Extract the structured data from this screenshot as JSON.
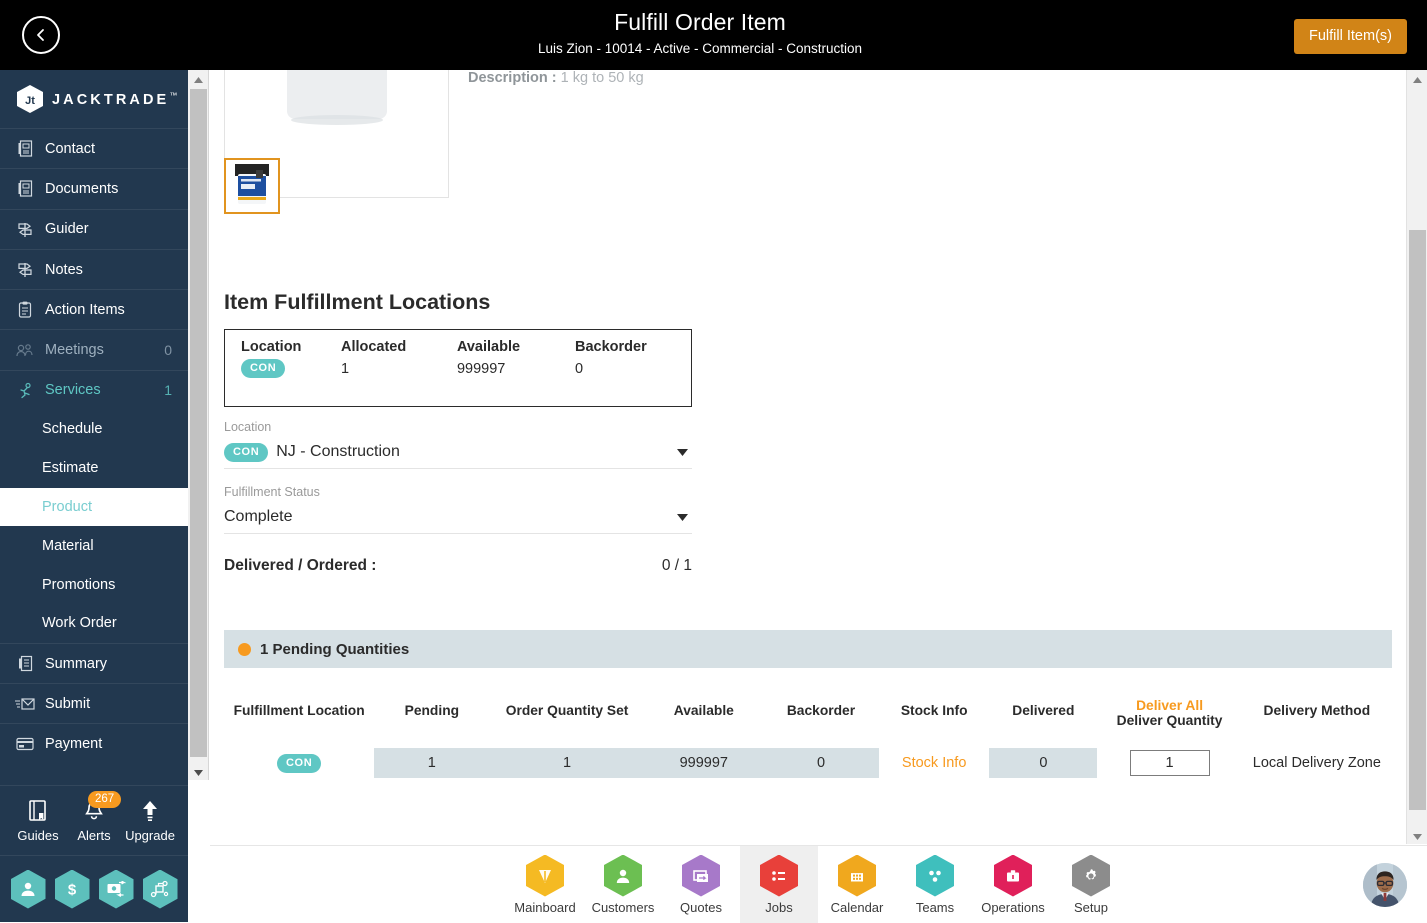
{
  "header": {
    "back_icon": "chevron-left-icon",
    "title": "Fulfill Order Item",
    "subtitle": "Luis Zion - 10014 - Active - Commercial - Construction",
    "fulfill_button": "Fulfill Item(s)",
    "accent_color": "#d18417",
    "background_color": "#000000"
  },
  "sidebar": {
    "brand": "JACKTRADE",
    "brand_tm": "™",
    "background_color": "#22384f",
    "active_color": "#79cdd0",
    "items": [
      {
        "label": "Contact",
        "icon": "contact-card-icon",
        "badge": ""
      },
      {
        "label": "Documents",
        "icon": "documents-icon",
        "badge": ""
      },
      {
        "label": "Guider",
        "icon": "signpost-icon",
        "badge": ""
      },
      {
        "label": "Notes",
        "icon": "signpost-icon",
        "badge": ""
      },
      {
        "label": "Action Items",
        "icon": "clipboard-icon",
        "badge": ""
      },
      {
        "label": "Meetings",
        "icon": "meetings-icon",
        "badge": "0"
      },
      {
        "label": "Services",
        "icon": "services-icon",
        "badge": "1"
      }
    ],
    "sub_items": [
      {
        "label": "Schedule",
        "active": false
      },
      {
        "label": "Estimate",
        "active": false
      },
      {
        "label": "Product",
        "active": true
      },
      {
        "label": "Material",
        "active": false
      },
      {
        "label": "Promotions",
        "active": false
      },
      {
        "label": "Work Order",
        "active": false
      }
    ],
    "items_after": [
      {
        "label": "Summary",
        "icon": "summary-icon",
        "badge": ""
      },
      {
        "label": "Submit",
        "icon": "submit-mail-icon",
        "badge": ""
      },
      {
        "label": "Payment",
        "icon": "payment-card-icon",
        "badge": ""
      }
    ],
    "tools": [
      {
        "label": "Guides",
        "icon": "book-icon",
        "badge": ""
      },
      {
        "label": "Alerts",
        "icon": "bell-icon",
        "badge": "267"
      },
      {
        "label": "Upgrade",
        "icon": "up-arrow-icon",
        "badge": ""
      }
    ],
    "hex_buttons": [
      {
        "icon": "person-icon"
      },
      {
        "icon": "dollar-icon"
      },
      {
        "icon": "money-transfer-icon"
      },
      {
        "icon": "workflow-icon"
      }
    ]
  },
  "main": {
    "description_label": "Description :",
    "description_value": "1 kg to 50 kg",
    "section_title": "Item Fulfillment Locations",
    "ifl_table": {
      "columns": [
        "Location",
        "Allocated",
        "Available",
        "Backorder"
      ],
      "rows": [
        {
          "location_badge": "CON",
          "allocated": "1",
          "available": "999997",
          "backorder": "0"
        }
      ]
    },
    "location_select": {
      "label": "Location",
      "badge": "CON",
      "value": "NJ - Construction",
      "caret_icon": "chevron-down-icon"
    },
    "status_select": {
      "label": "Fulfillment Status",
      "value": "Complete",
      "caret_icon": "chevron-down-icon"
    },
    "delivered_ordered": {
      "label": "Delivered / Ordered :",
      "value": "0 / 1"
    },
    "pending_banner": {
      "text": "1 Pending Quantities",
      "dot_color": "#f79a1f",
      "background_color": "#d6e0e4"
    },
    "pending_table": {
      "columns": [
        "Fulfillment Location",
        "Pending",
        "Order Quantity Set",
        "Available",
        "Backorder",
        "Stock Info",
        "Delivered",
        "Deliver Quantity",
        "Delivery Method"
      ],
      "deliver_all_label": "Deliver All",
      "rows": [
        {
          "location_badge": "CON",
          "pending": "1",
          "order_quantity_set": "1",
          "available": "999997",
          "backorder": "0",
          "stock_info": "Stock Info",
          "delivered": "0",
          "deliver_quantity_value": "1",
          "deliver_quantity_placeholder": "",
          "delivery_method": "Local Delivery Zone"
        }
      ]
    }
  },
  "bottom_nav": {
    "items": [
      {
        "label": "Mainboard",
        "icon": "mainboard-icon",
        "color": "#f5ba23",
        "active": false
      },
      {
        "label": "Customers",
        "icon": "customers-person-icon",
        "color": "#6cbf52",
        "active": false
      },
      {
        "label": "Quotes",
        "icon": "quotes-icon",
        "color": "#a779c9",
        "active": false
      },
      {
        "label": "Jobs",
        "icon": "jobs-list-icon",
        "color": "#e8403a",
        "active": true
      },
      {
        "label": "Calendar",
        "icon": "calendar-icon",
        "color": "#f0a81e",
        "active": false
      },
      {
        "label": "Teams",
        "icon": "teams-icon",
        "color": "#3fbfbd",
        "active": false
      },
      {
        "label": "Operations",
        "icon": "operations-briefcase-icon",
        "color": "#e0205a",
        "active": false
      },
      {
        "label": "Setup",
        "icon": "gear-icon",
        "color": "#8c8c8c",
        "active": false
      }
    ],
    "avatar_icon": "user-avatar"
  },
  "scrollbars": {
    "sidebar_up_icon": "triangle-up-icon",
    "sidebar_down_icon": "triangle-down-icon",
    "main_up_icon": "triangle-up-icon",
    "main_down_icon": "triangle-down-icon"
  }
}
